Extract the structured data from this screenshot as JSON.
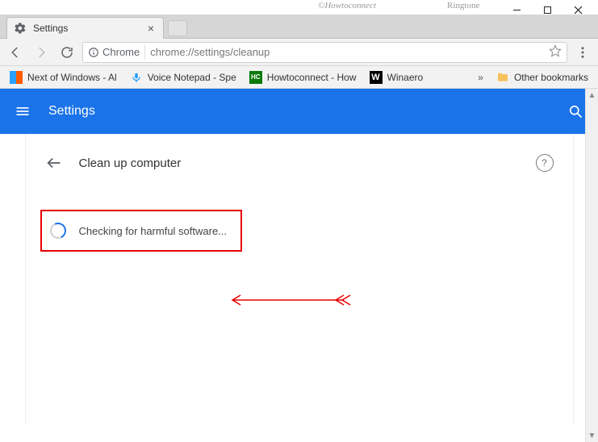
{
  "window": {
    "watermark1": "©Howtoconnect",
    "watermark2": "Ringtone"
  },
  "tab": {
    "title": "Settings"
  },
  "toolbar": {
    "security_chip": "Chrome",
    "url": "chrome://settings/cleanup"
  },
  "bookmarks": {
    "items": [
      {
        "label": "Next of Windows - Al"
      },
      {
        "label": "Voice Notepad - Spe"
      },
      {
        "label": "Howtoconnect - How"
      },
      {
        "label": "Winaero"
      }
    ],
    "overflow": "»",
    "other": "Other bookmarks"
  },
  "appbar": {
    "title": "Settings"
  },
  "page": {
    "heading": "Clean up computer",
    "status": "Checking for harmful software...",
    "help_glyph": "?"
  },
  "colors": {
    "primary": "#1a73e8",
    "annotation": "#e60000"
  }
}
